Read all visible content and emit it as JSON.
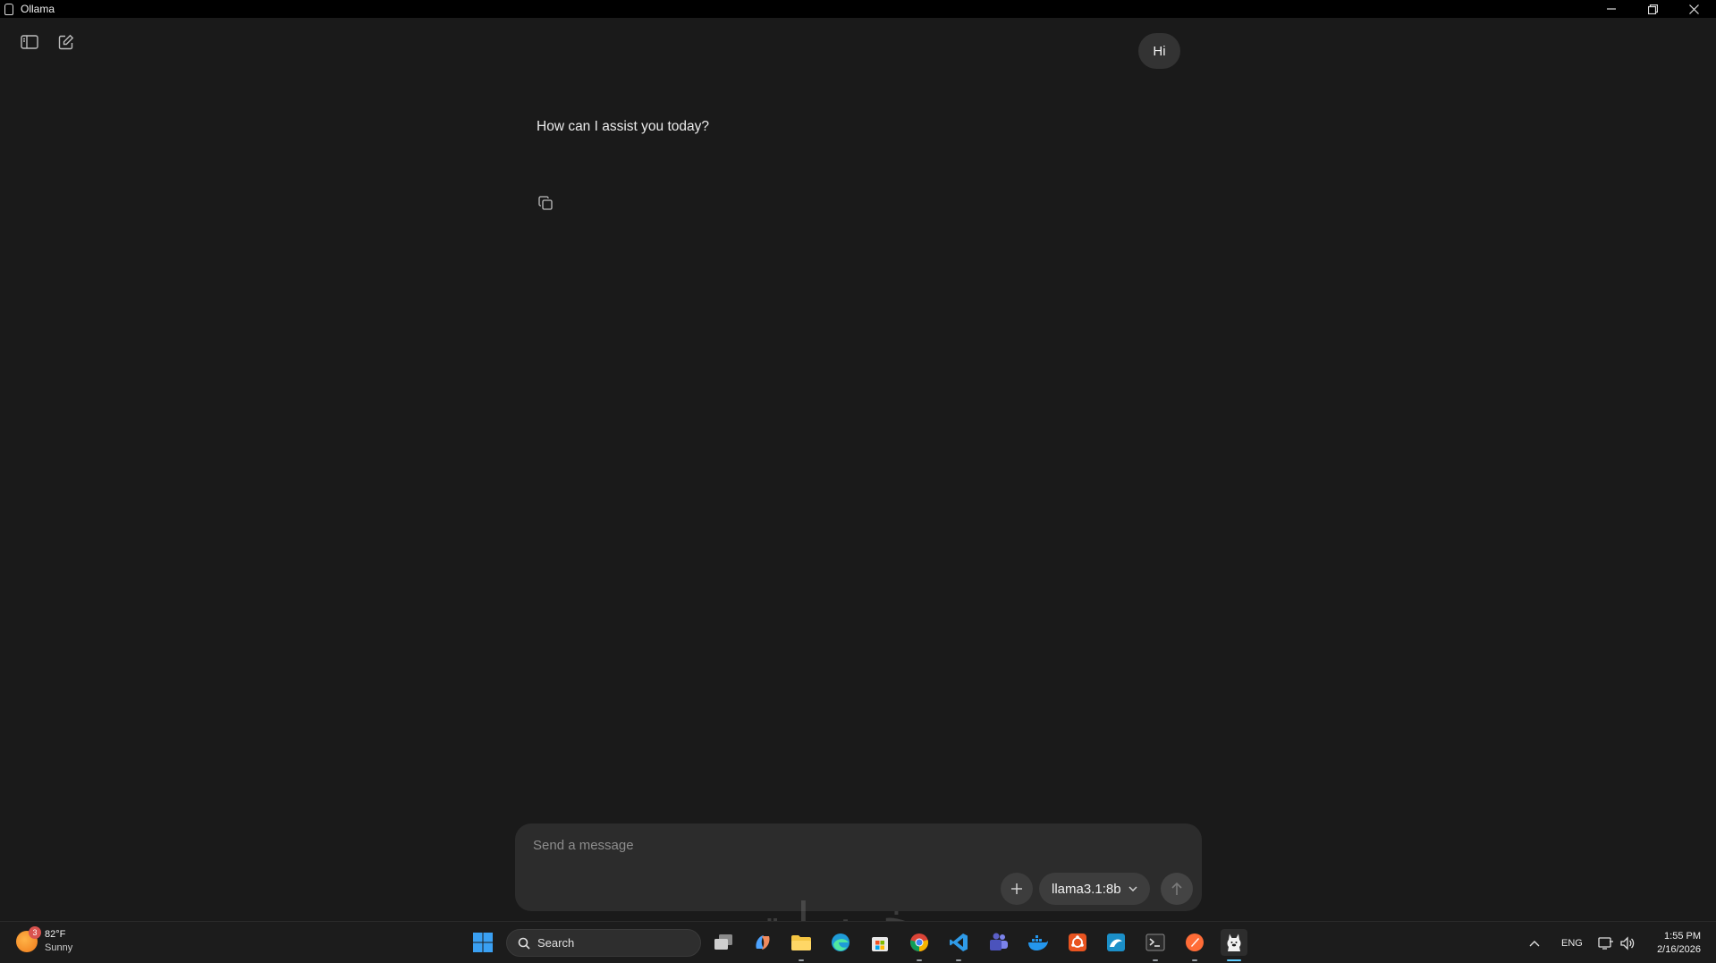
{
  "window": {
    "title": "Ollama",
    "controls": {
      "minimize": "minimize-icon",
      "restore": "restore-icon",
      "close": "close-icon"
    }
  },
  "toolbar": {
    "toggle_sidebar_icon": "sidebar-icon",
    "new_chat_icon": "new-chat-icon"
  },
  "conversation": {
    "user_message": "Hi",
    "assistant_message": "How can I assist you today?",
    "copy_icon": "copy-icon"
  },
  "composer": {
    "placeholder": "Send a message",
    "value": "",
    "add_icon": "plus-icon",
    "model": "llama3.1:8b",
    "send_icon": "arrow-up-icon"
  },
  "taskbar": {
    "weather": {
      "temperature": "82°F",
      "condition": "Sunny",
      "badge": "3"
    },
    "search_label": "Search",
    "apps": [
      "windows-start",
      "task-view",
      "copilot",
      "file-explorer",
      "edge",
      "microsoft-store",
      "chrome",
      "vscode",
      "teams",
      "docker",
      "ubuntu",
      "db-tool",
      "terminal",
      "postman",
      "ollama"
    ],
    "tray": {
      "language": "ENG",
      "time": "1:55 PM",
      "date": "2/16/2026"
    }
  },
  "watermark": "خمسات",
  "colors": {
    "background": "#1a1a1a",
    "composer": "#2c2c2c",
    "bubble": "#333333",
    "accent": "#60cdff"
  }
}
